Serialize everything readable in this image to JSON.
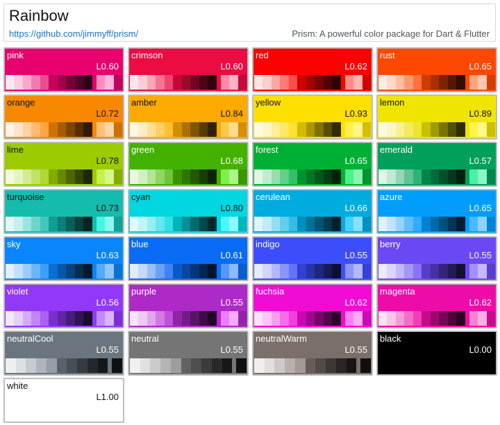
{
  "header": {
    "title": "Rainbow",
    "link": "https://github.com/jimmyff/prism/",
    "tagline": "Prism: A powerful color package for Dart & Flutter"
  },
  "colors": [
    {
      "name": "pink",
      "l": "L0.60",
      "base": "#e8006f",
      "text": "light",
      "sw": [
        "#fde6f0",
        "#fbcde1",
        "#f8a9cb",
        "#f27bb0",
        "#ec4c94",
        "#c8005e",
        "#a0004c",
        "#78003a",
        "#520028",
        "#2e0016",
        "#ff8ec0",
        "#ffb5d8",
        "#c2005f"
      ]
    },
    {
      "name": "crimson",
      "l": "L0.60",
      "base": "#ec0b43",
      "text": "light",
      "sw": [
        "#fde6eb",
        "#fbcdd7",
        "#f8a6b8",
        "#f37593",
        "#ee4470",
        "#c40938",
        "#9c072d",
        "#740522",
        "#4e0317",
        "#2c020c",
        "#ff8aa6",
        "#ffb3c5",
        "#c70a39"
      ]
    },
    {
      "name": "red",
      "l": "L0.62",
      "base": "#fb0100",
      "text": "light",
      "sw": [
        "#ffe6e5",
        "#ffcdcb",
        "#ffa7a4",
        "#ff7a76",
        "#ff4b46",
        "#d00100",
        "#a50100",
        "#7a0100",
        "#520100",
        "#2e0000",
        "#ff8b86",
        "#ffb6b2",
        "#d30100"
      ]
    },
    {
      "name": "rust",
      "l": "L0.65",
      "base": "#fc4800",
      "text": "light",
      "sw": [
        "#ffece5",
        "#ffd9cb",
        "#ffbc9f",
        "#ff9870",
        "#ff7240",
        "#d23c00",
        "#a83000",
        "#7c2300",
        "#541800",
        "#2f0d00",
        "#ffa37f",
        "#ffc6ad",
        "#d43d00"
      ]
    },
    {
      "name": "orange",
      "l": "L0.72",
      "base": "#f88800",
      "text": "dark",
      "sw": [
        "#fff3e5",
        "#ffe6cb",
        "#ffd19f",
        "#ffbb6f",
        "#ffa63f",
        "#d07200",
        "#a75b00",
        "#7c4400",
        "#552e00",
        "#2f1a00",
        "#ffbf78",
        "#ffd5a6",
        "#cf7100"
      ]
    },
    {
      "name": "amber",
      "l": "L0.84",
      "base": "#fcaa00",
      "text": "dark",
      "sw": [
        "#fff6e3",
        "#ffedc7",
        "#ffdf97",
        "#ffd062",
        "#ffbf2e",
        "#d38e00",
        "#a97200",
        "#7f5500",
        "#573a00",
        "#312100",
        "#ffc94d",
        "#ffdc8d",
        "#d58f00"
      ]
    },
    {
      "name": "yellow",
      "l": "L0.93",
      "base": "#fde000",
      "text": "dark",
      "sw": [
        "#fffbe3",
        "#fff6c6",
        "#ffef98",
        "#ffe862",
        "#ffe12e",
        "#d4bc00",
        "#aa9700",
        "#807100",
        "#574d00",
        "#312b00",
        "#fff04d",
        "#fff58d",
        "#d6bd00"
      ]
    },
    {
      "name": "lemon",
      "l": "L0.89",
      "base": "#f0e500",
      "text": "dark",
      "sw": [
        "#fdfbe2",
        "#fbf7c4",
        "#f7f194",
        "#f3eb5e",
        "#efe52a",
        "#c9c000",
        "#a19a00",
        "#797400",
        "#524f00",
        "#2e2c00",
        "#fff44a",
        "#fff88a",
        "#cbc100"
      ]
    },
    {
      "name": "lime",
      "l": "L0.78",
      "base": "#9ccc00",
      "text": "dark",
      "sw": [
        "#f3f9e0",
        "#e6f3c1",
        "#d4eb93",
        "#c1e262",
        "#aed835",
        "#83ab00",
        "#688800",
        "#4e6600",
        "#354600",
        "#1e2700",
        "#c4f14a",
        "#d8f78a",
        "#84ad00"
      ]
    },
    {
      "name": "green",
      "l": "L0.68",
      "base": "#43b100",
      "text": "light",
      "sw": [
        "#e9f7e0",
        "#d3efc1",
        "#b3e394",
        "#90d664",
        "#6cc736",
        "#389500",
        "#2d7700",
        "#225900",
        "#173d00",
        "#0d2200",
        "#7ef04a",
        "#aaf58a",
        "#399700"
      ]
    },
    {
      "name": "forest",
      "l": "L0.65",
      "base": "#00b035",
      "text": "light",
      "sw": [
        "#e0f6e7",
        "#c1eccf",
        "#94dfad",
        "#62d088",
        "#32c165",
        "#00942c",
        "#007623",
        "#00591a",
        "#003d12",
        "#00220a",
        "#4af088",
        "#8af5b1",
        "#00952d"
      ]
    },
    {
      "name": "emerald",
      "l": "L0.57",
      "base": "#00a05a",
      "text": "light",
      "sw": [
        "#e0f3ea",
        "#c1e7d5",
        "#94d6b7",
        "#62c395",
        "#32b177",
        "#00864b",
        "#006b3c",
        "#00502d",
        "#00371f",
        "#001f11",
        "#4af0a8",
        "#8af5c6",
        "#00884c"
      ]
    },
    {
      "name": "turquoise",
      "l": "L0.73",
      "base": "#14bcae",
      "text": "dark",
      "sw": [
        "#e2f7f5",
        "#c5efeb",
        "#9be3dc",
        "#6cd6cb",
        "#40c9bb",
        "#109e92",
        "#0d7e74",
        "#0a5f57",
        "#07413b",
        "#042421",
        "#45f5e2",
        "#8af9ec",
        "#11a093"
      ]
    },
    {
      "name": "cyan",
      "l": "L0.80",
      "base": "#00d7e0",
      "text": "dark",
      "sw": [
        "#e0fafb",
        "#c1f5f7",
        "#94eff2",
        "#62e8ec",
        "#32e0e6",
        "#00b4bc",
        "#009096",
        "#006c70",
        "#004a4d",
        "#00292b",
        "#4af7fd",
        "#8afafe",
        "#00b6be"
      ]
    },
    {
      "name": "cerulean",
      "l": "L0.66",
      "base": "#00abe0",
      "text": "light",
      "sw": [
        "#e0f5fb",
        "#c1ebf7",
        "#94ddf2",
        "#62ceec",
        "#32bee6",
        "#008fbc",
        "#007296",
        "#005670",
        "#003b4d",
        "#00212b",
        "#4ad0fd",
        "#8ae0fe",
        "#0091be"
      ]
    },
    {
      "name": "azure",
      "l": "L0.65",
      "base": "#009dfc",
      "text": "light",
      "sw": [
        "#e0f2ff",
        "#c1e5ff",
        "#94d3ff",
        "#62bfff",
        "#32abff",
        "#0083d3",
        "#0069a9",
        "#004f7f",
        "#003657",
        "#001e31",
        "#4ab9ff",
        "#8ad2ff",
        "#0085d5"
      ]
    },
    {
      "name": "sky",
      "l": "L0.63",
      "base": "#0a86fc",
      "text": "light",
      "sw": [
        "#e1f0ff",
        "#c3e1ff",
        "#99cdff",
        "#6ab6ff",
        "#3b9fff",
        "#0870d3",
        "#0659a9",
        "#05437f",
        "#032e57",
        "#021a31",
        "#55a9ff",
        "#8fc6ff",
        "#0872d5"
      ]
    },
    {
      "name": "blue",
      "l": "L0.61",
      "base": "#0a6cf4",
      "text": "light",
      "sw": [
        "#e1ecfe",
        "#c3d9fd",
        "#99bffb",
        "#6aa1f8",
        "#3b84f6",
        "#085acc",
        "#0648a3",
        "#05367a",
        "#032553",
        "#02152f",
        "#5596ff",
        "#8fbaff",
        "#085cce"
      ]
    },
    {
      "name": "indigo",
      "l": "L0.55",
      "base": "#3c4efc",
      "text": "light",
      "sw": [
        "#e8eaff",
        "#d1d5ff",
        "#b1b8ff",
        "#8b95ff",
        "#6572ff",
        "#3241d3",
        "#2834a9",
        "#1e277f",
        "#151b57",
        "#0b0f31",
        "#8a95ff",
        "#b2b9ff",
        "#3342d5"
      ]
    },
    {
      "name": "berry",
      "l": "L0.55",
      "base": "#6a48f4",
      "text": "light",
      "sw": [
        "#eeeafe",
        "#ddd5fd",
        "#c5b7fb",
        "#a895f8",
        "#8b73f6",
        "#583ccc",
        "#4730a3",
        "#35247a",
        "#251953",
        "#150e2f",
        "#a48fff",
        "#c6b7ff",
        "#5a3dce"
      ]
    },
    {
      "name": "violet",
      "l": "L0.56",
      "base": "#9238f8",
      "text": "light",
      "sw": [
        "#f3e7fe",
        "#e7cffd",
        "#d5acfc",
        "#c185fa",
        "#ad5ef9",
        "#7a2ecf",
        "#6225a6",
        "#491c7c",
        "#321355",
        "#1c0b30",
        "#c389ff",
        "#dab4ff",
        "#7c2fd1"
      ]
    },
    {
      "name": "purple",
      "l": "L0.55",
      "base": "#ae2ac8",
      "text": "light",
      "sw": [
        "#f6e5f9",
        "#edcbf4",
        "#e0a6ec",
        "#d17be2",
        "#c251d8",
        "#9123a7",
        "#741c85",
        "#571564",
        "#3c0e45",
        "#220827",
        "#ec7eff",
        "#f3adff",
        "#9324a9"
      ]
    },
    {
      "name": "fuchsia",
      "l": "L0.62",
      "base": "#f00cd4",
      "text": "light",
      "sw": [
        "#fde2fa",
        "#fcc5f5",
        "#fa9cee",
        "#f76de6",
        "#f43ede",
        "#c90ab1",
        "#a0088d",
        "#78066a",
        "#520449",
        "#2e0229",
        "#ff7ff0",
        "#ffadf5",
        "#cb0ab3"
      ]
    },
    {
      "name": "magenta",
      "l": "L0.62",
      "base": "#ee0ca8",
      "text": "light",
      "sw": [
        "#fde2f4",
        "#fbc5e9",
        "#f89cd9",
        "#f46dc7",
        "#f13eb5",
        "#c70a8c",
        "#9f0870",
        "#770654",
        "#51043a",
        "#2e0220",
        "#ff7fd3",
        "#ffade4",
        "#c90a8e"
      ]
    },
    {
      "name": "neutralCool",
      "l": "L0.55",
      "base": "#6a757f",
      "text": "light",
      "sw": [
        "#eef0f1",
        "#dde0e3",
        "#c6cbd0",
        "#adb4bb",
        "#949ea6",
        "#58626a",
        "#474e55",
        "#353b40",
        "#25292c",
        "#151719",
        "#0e1113"
      ]
    },
    {
      "name": "neutral",
      "l": "L0.55",
      "base": "#757575",
      "text": "light",
      "sw": [
        "#f0f0f0",
        "#e1e1e1",
        "#cbcbcb",
        "#b4b4b4",
        "#9e9e9e",
        "#626262",
        "#4e4e4e",
        "#3b3b3b",
        "#292929",
        "#171717",
        "#101010"
      ]
    },
    {
      "name": "neutralWarm",
      "l": "L0.55",
      "base": "#7b6f6a",
      "text": "light",
      "sw": [
        "#f1efee",
        "#e2dfdd",
        "#cec8c6",
        "#b8b0ad",
        "#a29996",
        "#665d59",
        "#524a47",
        "#3e3835",
        "#2a2625",
        "#181614",
        "#110f0e"
      ]
    },
    {
      "name": "black",
      "l": "L0.00",
      "base": "#000000",
      "text": "light",
      "sw": []
    },
    {
      "name": "white",
      "l": "L1.00",
      "base": "#ffffff",
      "text": "dark",
      "sw": []
    }
  ]
}
